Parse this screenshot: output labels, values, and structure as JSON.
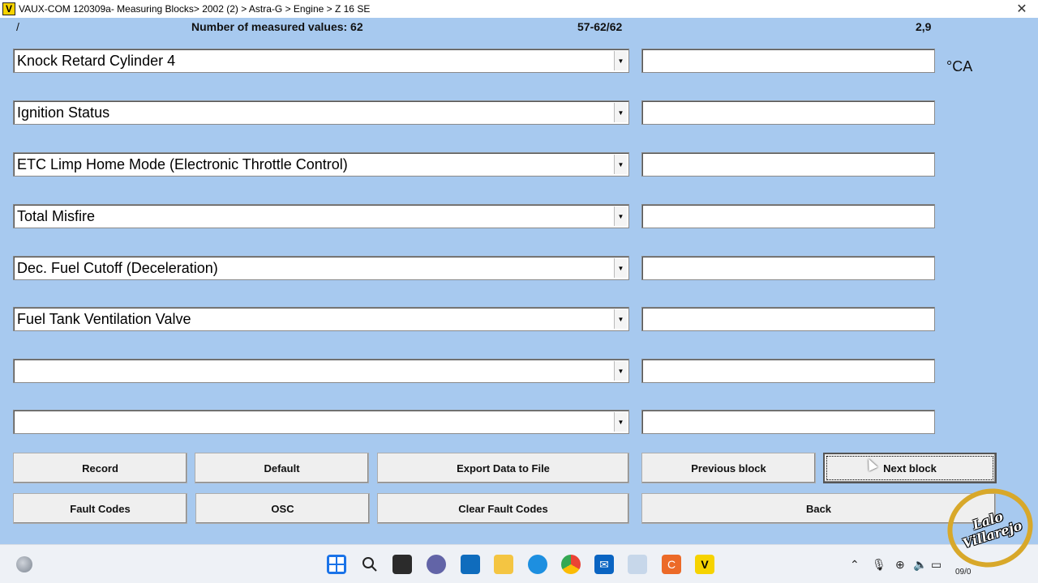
{
  "window": {
    "icon_letter": "V",
    "title": "VAUX-COM 120309a- Measuring Blocks> 2002 (2) > Astra-G > Engine > Z 16 SE",
    "close_glyph": "✕"
  },
  "header": {
    "slash": "/",
    "measured_count": "Number of measured values: 62",
    "range": "57-62/62",
    "value": "2,9"
  },
  "rows": [
    {
      "label": "Knock Retard Cylinder 4",
      "value": "",
      "unit": "°CA"
    },
    {
      "label": "Ignition Status",
      "value": "",
      "unit": ""
    },
    {
      "label": "ETC Limp Home Mode (Electronic Throttle Control)",
      "value": "",
      "unit": ""
    },
    {
      "label": "Total Misfire",
      "value": "",
      "unit": ""
    },
    {
      "label": "Dec. Fuel Cutoff (Deceleration)",
      "value": "",
      "unit": ""
    },
    {
      "label": "Fuel Tank Ventilation Valve",
      "value": "",
      "unit": ""
    },
    {
      "label": "",
      "value": "",
      "unit": ""
    },
    {
      "label": "",
      "value": "",
      "unit": ""
    }
  ],
  "buttons": {
    "record": "Record",
    "default": "Default",
    "export": "Export Data to File",
    "previous": "Previous block",
    "next": "Next block",
    "fault_codes": "Fault Codes",
    "osc": "OSC",
    "clear_fault_codes": "Clear Fault Codes",
    "back": "Back"
  },
  "taskbar": {
    "date": "09/0",
    "pinned": [
      "windows-start-icon",
      "search-icon",
      "task-view-icon",
      "teams-chat-icon",
      "store-icon",
      "file-explorer-icon",
      "edge-icon",
      "chrome-icon",
      "mail-icon",
      "paint-icon",
      "camtasia-icon",
      "vaux-com-icon"
    ],
    "tray": [
      "chevron-up-icon",
      "microphone-icon",
      "network-icon",
      "volume-icon",
      "battery-icon"
    ]
  },
  "watermark": {
    "line1": "Lalo",
    "line2": "Villarejo"
  },
  "colors": {
    "background": "#a7c9ef",
    "accent": "#f6d300"
  }
}
